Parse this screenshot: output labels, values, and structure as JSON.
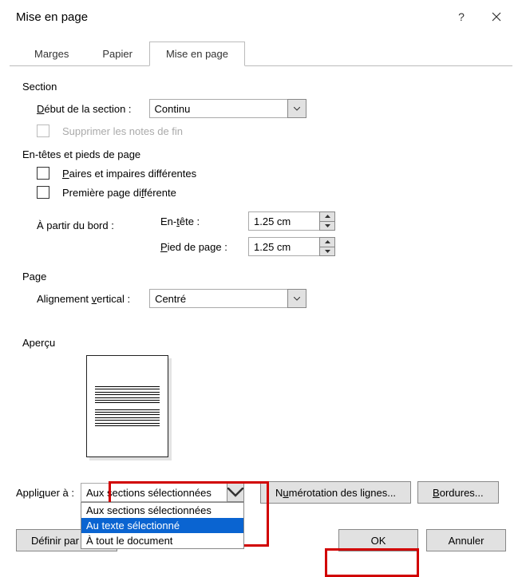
{
  "window": {
    "title": "Mise en page"
  },
  "tabs": [
    "Marges",
    "Papier",
    "Mise en page"
  ],
  "section": {
    "group_label": "Section",
    "start_label_pre": "",
    "start_label": "Début de la section :",
    "start_value": "Continu",
    "suppress_notes": "Supprimer les notes de fin"
  },
  "headers": {
    "group_label": "En-têtes et pieds de page",
    "diff_odd_even": "Paires et impaires différentes",
    "diff_first": "Première page différente",
    "from_edge_label": "À partir du bord :",
    "header_label": "En-tête :",
    "footer_label": "Pied de page :",
    "header_value": "1.25 cm",
    "footer_value": "1.25 cm"
  },
  "page": {
    "group_label": "Page",
    "valign_label": "Alignement vertical :",
    "valign_value": "Centré"
  },
  "preview": {
    "label": "Aperçu"
  },
  "apply": {
    "label": "Appliquer à :",
    "value": "Aux sections sélectionnées",
    "options": [
      "Aux sections sélectionnées",
      "Au texte sélectionné",
      "À tout le document"
    ],
    "selected_index": 1
  },
  "buttons": {
    "line_numbers": "Numérotation des lignes...",
    "borders": "Bordures...",
    "set_default": "Définir par défa",
    "ok": "OK",
    "cancel": "Annuler"
  }
}
